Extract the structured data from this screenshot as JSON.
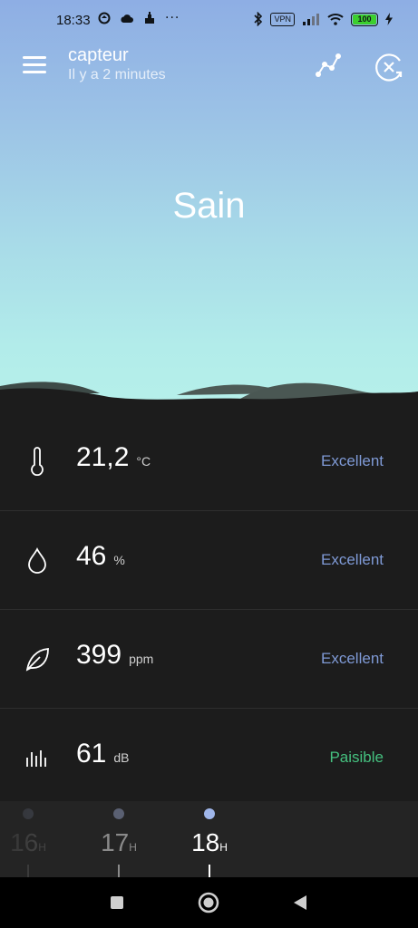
{
  "statusbar": {
    "time": "18:33",
    "icons_left": [
      "app-icon",
      "cloud-icon",
      "app-icon",
      "more-icon"
    ],
    "icons_right": [
      "bluetooth-icon",
      "vpn-icon",
      "signal-icon",
      "wifi-icon",
      "battery-icon",
      "charging-icon"
    ],
    "vpn_label": "VPN",
    "battery_level": "100",
    "more_label": "···"
  },
  "header": {
    "device_name": "capteur",
    "last_update": "Il y a 2 minutes"
  },
  "status_word": "Sain",
  "metrics": [
    {
      "icon": "thermometer-icon",
      "value": "21,2",
      "unit": "°C",
      "rating": "Excellent",
      "rating_color": "#7f9ad6"
    },
    {
      "icon": "droplet-icon",
      "value": "46",
      "unit": "%",
      "rating": "Excellent",
      "rating_color": "#7f9ad6"
    },
    {
      "icon": "leaf-icon",
      "value": "399",
      "unit": "ppm",
      "rating": "Excellent",
      "rating_color": "#7f9ad6"
    },
    {
      "icon": "sound-bars-icon",
      "value": "61",
      "unit": "dB",
      "rating": "Paisible",
      "rating_color": "#45c07f"
    }
  ],
  "timeline": {
    "hours": [
      {
        "label": "16",
        "suffix": "H"
      },
      {
        "label": "17",
        "suffix": "H"
      },
      {
        "label": "18",
        "suffix": "H"
      }
    ]
  },
  "colors": {
    "accent_blue": "#7f9ad6",
    "accent_green": "#45c07f",
    "background": "#1c1c1c",
    "sky_top": "#8eaee4",
    "sky_bottom": "#b6f0ea"
  }
}
